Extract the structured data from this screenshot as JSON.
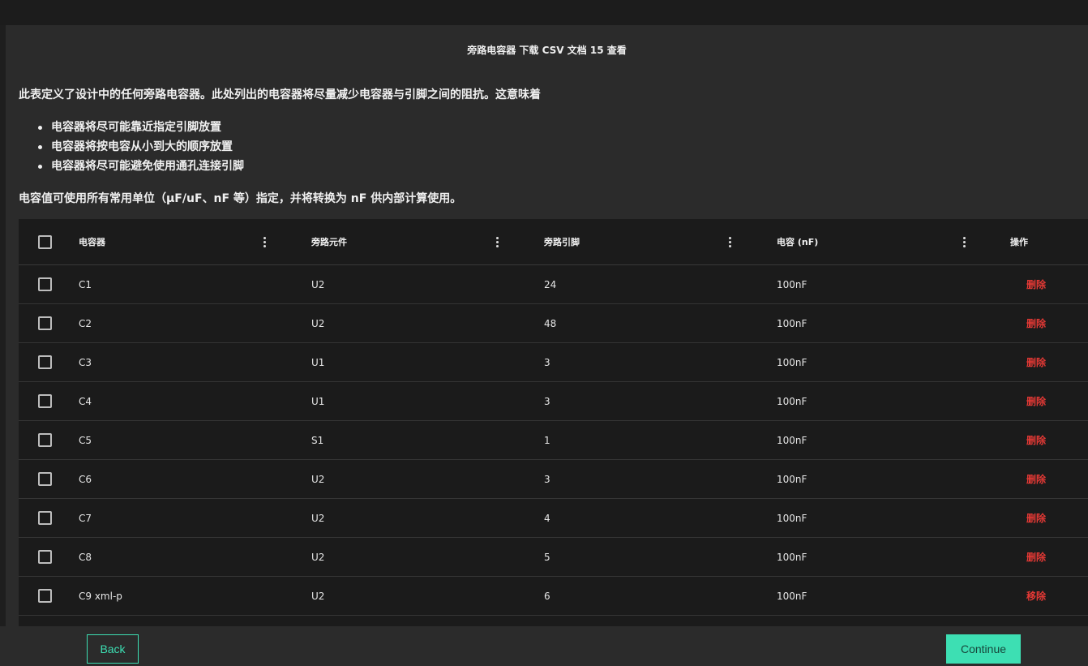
{
  "panel": {
    "title": "旁路电容器 下载 CSV 文档 15 查看",
    "intro": "此表定义了设计中的任何旁路电容器。此处列出的电容器将尽量减少电容器与引脚之间的阻抗。这意味着",
    "bullets": [
      "电容器将尽可能靠近指定引脚放置",
      "电容器将按电容从小到大的顺序放置",
      "电容器将尽可能避免使用通孔连接引脚"
    ],
    "units_note": "电容值可使用所有常用单位（µF/uF、nF 等）指定，并将转换为 nF 供内部计算使用。"
  },
  "table": {
    "headers": [
      "电容器",
      "旁路元件",
      "旁路引脚",
      "电容 (nF)",
      "操作"
    ],
    "rows": [
      {
        "cap": "C1",
        "part": "U2",
        "pin": "24",
        "value": "100nF",
        "action": "删除"
      },
      {
        "cap": "C2",
        "part": "U2",
        "pin": "48",
        "value": "100nF",
        "action": "删除"
      },
      {
        "cap": "C3",
        "part": "U1",
        "pin": "3",
        "value": "100nF",
        "action": "删除"
      },
      {
        "cap": "C4",
        "part": "U1",
        "pin": "3",
        "value": "100nF",
        "action": "删除"
      },
      {
        "cap": "C5",
        "part": "S1",
        "pin": "1",
        "value": "100nF",
        "action": "删除"
      },
      {
        "cap": "C6",
        "part": "U2",
        "pin": "3",
        "value": "100nF",
        "action": "删除"
      },
      {
        "cap": "C7",
        "part": "U2",
        "pin": "4",
        "value": "100nF",
        "action": "删除"
      },
      {
        "cap": "C8",
        "part": "U2",
        "pin": "5",
        "value": "100nF",
        "action": "删除"
      },
      {
        "cap": "C9 xml-p",
        "part": "U2",
        "pin": "6",
        "value": "100nF",
        "action": "移除"
      }
    ]
  },
  "footer": {
    "back_label": "Back",
    "continue_label": "Continue"
  },
  "colors": {
    "accent": "#3ddfb3",
    "danger": "#e53935",
    "panel_bg": "#2b2b2b",
    "table_bg": "#1b1b1b"
  }
}
